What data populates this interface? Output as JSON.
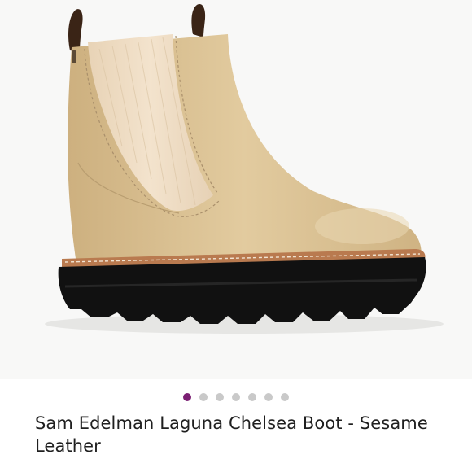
{
  "product": {
    "title": "Sam Edelman Laguna Chelsea Boot - Sesame Leather",
    "image_icon": "chelsea-boot-image"
  },
  "carousel": {
    "count": 7,
    "active_index": 0,
    "active_color": "#7b1f73",
    "inactive_color": "#c9c9c9"
  },
  "colors": {
    "leather": "#ddc394",
    "elastic": "#efdcc3",
    "welt": "#b97a4f",
    "sole": "#111111"
  }
}
